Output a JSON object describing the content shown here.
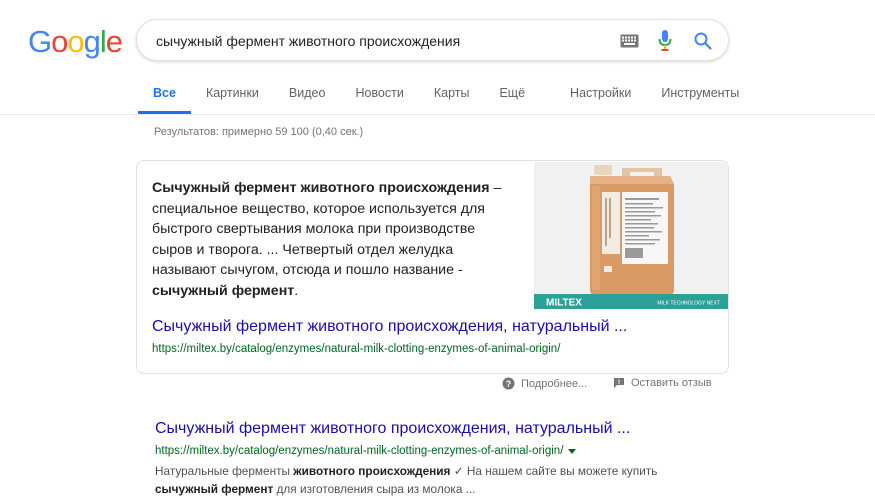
{
  "logo": {
    "letters": [
      "G",
      "o",
      "o",
      "g",
      "l",
      "e"
    ],
    "colors": [
      "#4285f4",
      "#ea4335",
      "#fbbc05",
      "#4285f4",
      "#34a853",
      "#ea4335"
    ]
  },
  "search": {
    "value": "сычужный фермент животного происхождения",
    "keyboard_icon": "keyboard-icon",
    "mic_icon": "mic-icon",
    "search_icon": "search-icon"
  },
  "tabs": [
    {
      "label": "Все",
      "active": true
    },
    {
      "label": "Картинки"
    },
    {
      "label": "Видео"
    },
    {
      "label": "Новости"
    },
    {
      "label": "Карты"
    },
    {
      "label": "Ещё"
    },
    {
      "label": "Настройки"
    },
    {
      "label": "Инструменты"
    }
  ],
  "result_stats": "Результатов: примерно 59 100 (0,40 сек.)",
  "featured": {
    "text_bold_1": "Сычужный фермент животного происхождения",
    "text_mid": " – специальное вещество, которое используется для быстрого свертывания молока при производстве сыров и творога. ... Четвертый отдел желудка называют сычугом, отсюда и пошло название - ",
    "text_bold_2": "сычужный фермент",
    "text_end": ".",
    "image_brand": "MILTEX",
    "image_tagline": "MILK TECHNOLOGY NEXT",
    "title": "Сычужный фермент животного происхождения, натуральный ...",
    "url": "https://miltex.by/catalog/enzymes/natural-milk-clotting-enzymes-of-animal-origin/"
  },
  "feedback": {
    "details": "Подробнее...",
    "report": "Оставить отзыв"
  },
  "result": {
    "title": "Сычужный фермент животного происхождения, натуральный ...",
    "url": "https://miltex.by/catalog/enzymes/natural-milk-clotting-enzymes-of-animal-origin/",
    "snippet_1": "Натуральные ферменты ",
    "snippet_b1": "животного происхождения",
    "snippet_2": " ✓ На нашем сайте вы можете купить ",
    "snippet_b2": "сычужный фермент",
    "snippet_3": " для изготовления сыра из молока ..."
  }
}
